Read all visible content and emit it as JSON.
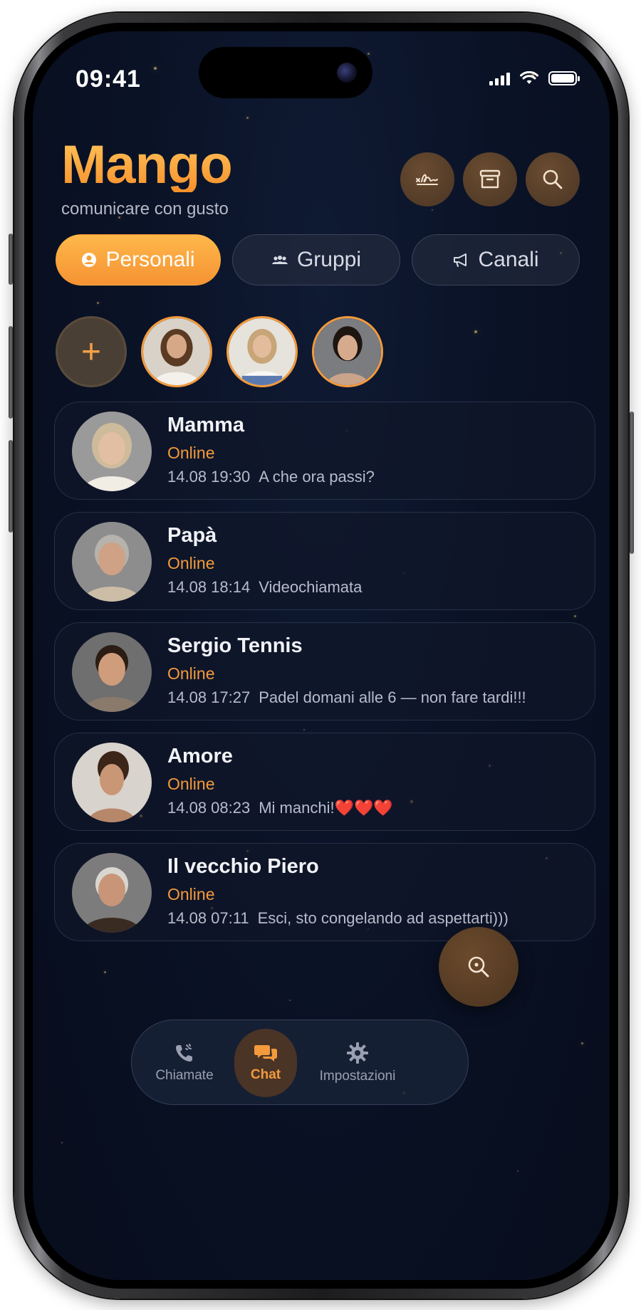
{
  "status_bar": {
    "time": "09:41"
  },
  "brand": {
    "title": "Mango",
    "subtitle": "comunicare con gusto"
  },
  "header_buttons": [
    {
      "icon": "signature-icon"
    },
    {
      "icon": "archive-icon"
    },
    {
      "icon": "search-icon"
    }
  ],
  "tabs": [
    {
      "label": "Personali",
      "icon": "person-icon",
      "active": true
    },
    {
      "label": "Gruppi",
      "icon": "group-icon",
      "active": false
    },
    {
      "label": "Canali",
      "icon": "megaphone-icon",
      "active": false
    }
  ],
  "stories": {
    "add_symbol": "+"
  },
  "chats": [
    {
      "name": "Mamma",
      "status": "Online",
      "time": "14.08 19:30",
      "message": "A che ora passi?"
    },
    {
      "name": "Papà",
      "status": "Online",
      "time": "14.08 18:14",
      "message": "Videochiamata"
    },
    {
      "name": "Sergio Tennis",
      "status": "Online",
      "time": "14.08 17:27",
      "message": "Padel domani alle 6 — non fare tardi!!!"
    },
    {
      "name": "Amore",
      "status": "Online",
      "time": "14.08 08:23",
      "message": "Mi manchi!❤️❤️❤️"
    },
    {
      "name": "Il vecchio Piero",
      "status": "Online",
      "time": "14.08 07:11",
      "message": "Esci, sto congelando ad aspettarti)))"
    }
  ],
  "bottom_nav": [
    {
      "label": "Chiamate",
      "icon": "phone-icon",
      "active": false
    },
    {
      "label": "Chat",
      "icon": "chat-icon",
      "active": true
    },
    {
      "label": "Impostazioni",
      "icon": "gear-icon",
      "active": false
    }
  ],
  "colors": {
    "accent": "#f39a3c",
    "background": "#0a1226"
  }
}
